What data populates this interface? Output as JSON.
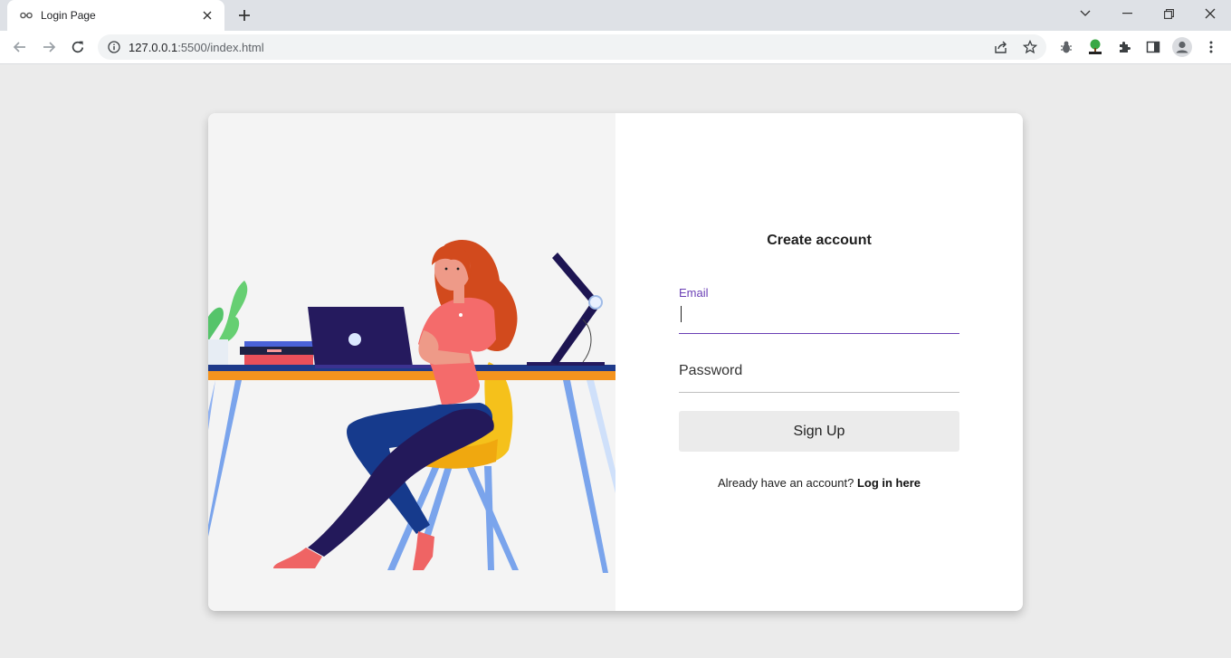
{
  "browser": {
    "tab_title": "Login Page",
    "url_host": "127.0.0.1",
    "url_path": ":5500/index.html",
    "icons": [
      "back-arrow-icon",
      "forward-arrow-icon",
      "reload-icon",
      "info-icon",
      "share-icon",
      "star-icon",
      "bug-extension-icon",
      "tree-extension-icon",
      "puzzle-extensions-icon",
      "side-panel-icon",
      "profile-avatar-icon",
      "kebab-menu-icon"
    ]
  },
  "page": {
    "title": "Create account",
    "email_label": "Email",
    "email_value": "",
    "password_label": "Password",
    "signup_label": "Sign Up",
    "login_prompt": "Already have an account?",
    "login_link": "Log in here"
  },
  "colors": {
    "accent": "#6a3fb5",
    "page_bg": "#ebebeb",
    "illustration_bg": "#f4f4f4",
    "desk_top": "#1e3a8a",
    "desk_edge": "#f4931e",
    "shirt": "#f46b6b",
    "hair": "#d24a1d",
    "chair": "#f5c11b",
    "pants": "#23195a"
  }
}
